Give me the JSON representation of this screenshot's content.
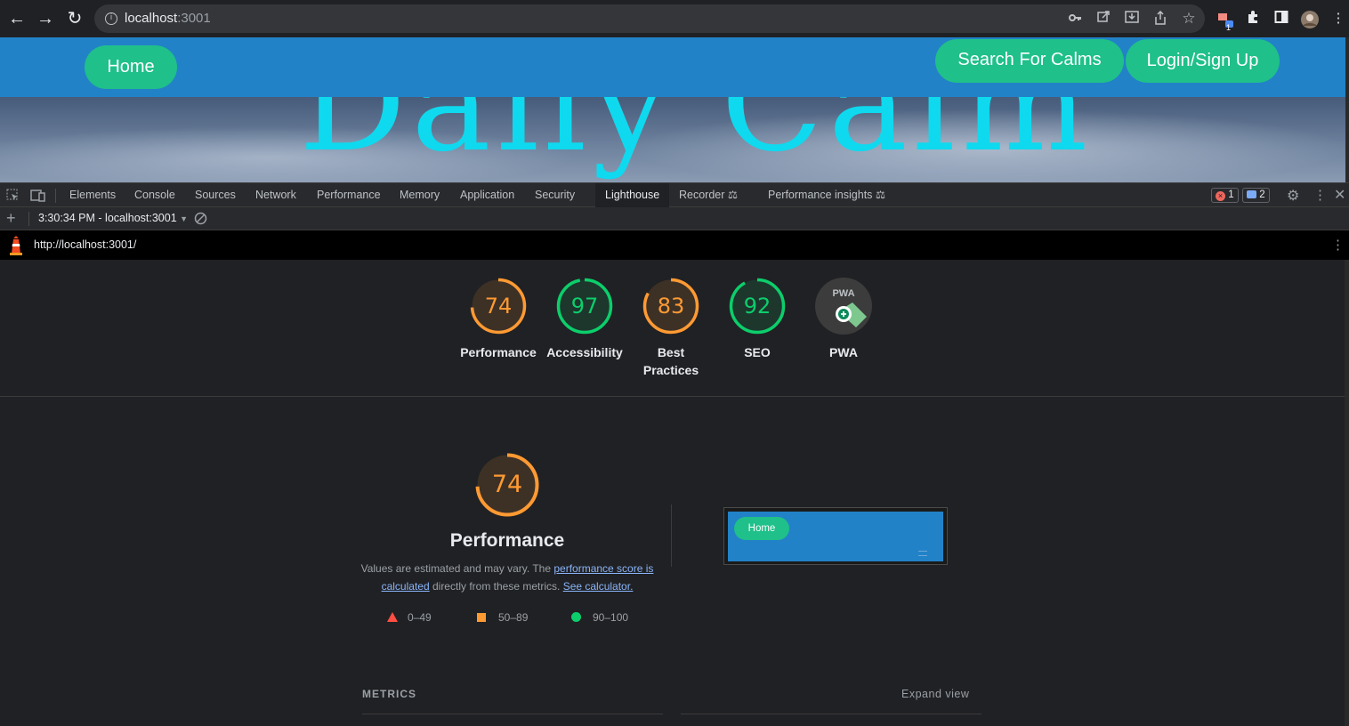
{
  "browser": {
    "url_host": "localhost",
    "url_port": ":3001",
    "extension_badge": "1"
  },
  "site": {
    "title_text": "Daily Calm",
    "nav": {
      "home": "Home",
      "search": "Search For Calms",
      "login": "Login/Sign Up"
    }
  },
  "devtools": {
    "tabs": [
      "Elements",
      "Console",
      "Sources",
      "Network",
      "Performance",
      "Memory",
      "Application",
      "Security",
      "Lighthouse",
      "Recorder",
      "Performance insights"
    ],
    "active_tab": "Lighthouse",
    "error_count": "1",
    "message_count": "2",
    "report_selector": "3:30:34 PM - localhost:3001",
    "lighthouse_url": "http://localhost:3001/"
  },
  "report": {
    "scores": [
      {
        "name": "Performance",
        "value": 74,
        "color": "#ff9a33"
      },
      {
        "name": "Accessibility",
        "value": 97,
        "color": "#0cce6b"
      },
      {
        "name": "Best Practices",
        "value": 83,
        "color": "#ff9a33"
      },
      {
        "name": "SEO",
        "value": 92,
        "color": "#0cce6b"
      },
      {
        "name": "PWA",
        "value": null,
        "color": "#9aa0a6"
      }
    ],
    "pwa_badge_text": "PWA",
    "main_score": 74,
    "main_title": "Performance",
    "desc_prefix": "Values are estimated and may vary. The ",
    "desc_link1": "performance score is calculated",
    "desc_mid": " directly from these metrics. ",
    "desc_link2": "See calculator.",
    "legend": [
      {
        "range": "0–49",
        "color": "#ff4e42"
      },
      {
        "range": "50–89",
        "color": "#ff9a33"
      },
      {
        "range": "90–100",
        "color": "#0cce6b"
      }
    ],
    "thumbnail_button": "Home",
    "metrics_label": "METRICS",
    "expand_view": "Expand view"
  }
}
